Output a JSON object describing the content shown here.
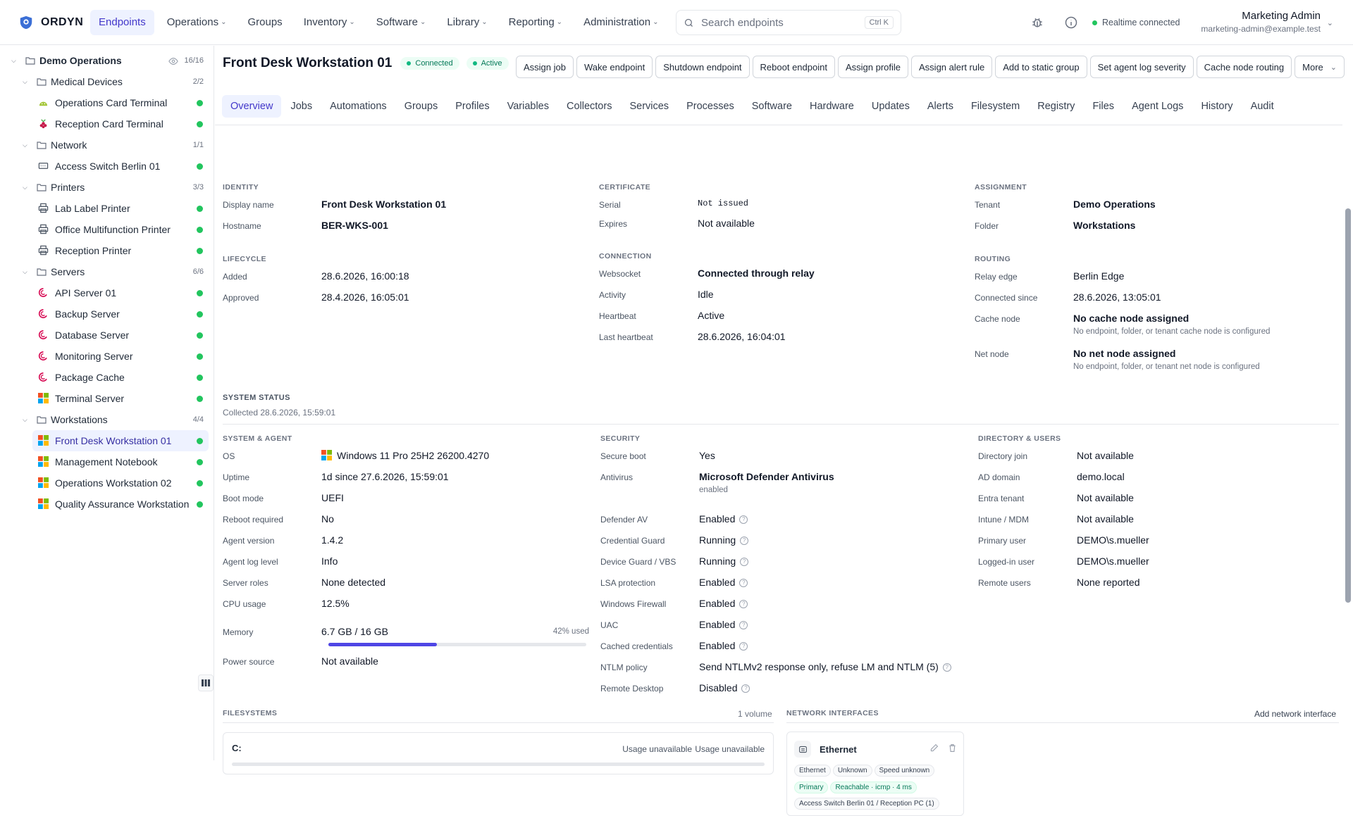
{
  "app": {
    "name": "ORDYN"
  },
  "nav": {
    "items": [
      {
        "label": "Endpoints",
        "dropdown": false,
        "active": true
      },
      {
        "label": "Operations",
        "dropdown": true
      },
      {
        "label": "Groups",
        "dropdown": false
      },
      {
        "label": "Inventory",
        "dropdown": true
      },
      {
        "label": "Software",
        "dropdown": true
      },
      {
        "label": "Library",
        "dropdown": true
      },
      {
        "label": "Reporting",
        "dropdown": true
      },
      {
        "label": "Administration",
        "dropdown": true
      }
    ]
  },
  "search": {
    "placeholder": "Search endpoints",
    "shortcut": "Ctrl K"
  },
  "realtime": {
    "label": "Realtime connected",
    "color": "#22c55e"
  },
  "user": {
    "name": "Marketing Admin",
    "email": "marketing-admin@example.test"
  },
  "tree": {
    "root": {
      "label": "Demo Operations",
      "count": "16/16"
    },
    "groups": [
      {
        "label": "Medical Devices",
        "count": "2/2",
        "items": [
          {
            "label": "Operations Card Terminal",
            "os": "android"
          },
          {
            "label": "Reception Card Terminal",
            "os": "raspberry"
          }
        ]
      },
      {
        "label": "Network",
        "count": "1/1",
        "items": [
          {
            "label": "Access Switch Berlin 01",
            "os": "switch"
          }
        ]
      },
      {
        "label": "Printers",
        "count": "3/3",
        "items": [
          {
            "label": "Lab Label Printer",
            "os": "printer"
          },
          {
            "label": "Office Multifunction Printer",
            "os": "printer"
          },
          {
            "label": "Reception Printer",
            "os": "printer"
          }
        ]
      },
      {
        "label": "Servers",
        "count": "6/6",
        "items": [
          {
            "label": "API Server 01",
            "os": "debian"
          },
          {
            "label": "Backup Server",
            "os": "debian"
          },
          {
            "label": "Database Server",
            "os": "debian"
          },
          {
            "label": "Monitoring Server",
            "os": "debian"
          },
          {
            "label": "Package Cache",
            "os": "debian"
          },
          {
            "label": "Terminal Server",
            "os": "windows"
          }
        ]
      },
      {
        "label": "Workstations",
        "count": "4/4",
        "items": [
          {
            "label": "Front Desk Workstation 01",
            "os": "windows",
            "selected": true
          },
          {
            "label": "Management Notebook",
            "os": "windows"
          },
          {
            "label": "Operations Workstation 02",
            "os": "windows"
          },
          {
            "label": "Quality Assurance Workstation",
            "os": "windows"
          }
        ]
      }
    ]
  },
  "header": {
    "title": "Front Desk Workstation 01",
    "status_connected": "Connected",
    "status_active": "Active",
    "actions": [
      "Assign job",
      "Wake endpoint",
      "Shutdown endpoint",
      "Reboot endpoint",
      "Assign profile",
      "Assign alert rule",
      "Add to static group",
      "Set agent log severity",
      "Cache node routing",
      "More"
    ]
  },
  "tabs": [
    "Overview",
    "Jobs",
    "Automations",
    "Groups",
    "Profiles",
    "Variables",
    "Collectors",
    "Services",
    "Processes",
    "Software",
    "Hardware",
    "Updates",
    "Alerts",
    "Filesystem",
    "Registry",
    "Files",
    "Agent Logs",
    "History",
    "Audit"
  ],
  "identity": {
    "title": "IDENTITY",
    "display_name_label": "Display name",
    "display_name": "Front Desk Workstation 01",
    "hostname_label": "Hostname",
    "hostname": "BER-WKS-001"
  },
  "lifecycle": {
    "title": "LIFECYCLE",
    "added_label": "Added",
    "added": "28.6.2026, 16:00:18",
    "approved_label": "Approved",
    "approved": "28.4.2026, 16:05:01"
  },
  "certificate": {
    "title": "CERTIFICATE",
    "serial_label": "Serial",
    "serial": "Not issued",
    "expires_label": "Expires",
    "expires": "Not available"
  },
  "connection": {
    "title": "CONNECTION",
    "websocket_label": "Websocket",
    "websocket": "Connected through relay",
    "activity_label": "Activity",
    "activity": "Idle",
    "heartbeat_label": "Heartbeat",
    "heartbeat": "Active",
    "last_heartbeat_label": "Last heartbeat",
    "last_heartbeat": "28.6.2026, 16:04:01"
  },
  "assignment": {
    "title": "ASSIGNMENT",
    "tenant_label": "Tenant",
    "tenant": "Demo Operations",
    "folder_label": "Folder",
    "folder": "Workstations"
  },
  "routing": {
    "title": "ROUTING",
    "relay_label": "Relay edge",
    "relay": "Berlin Edge",
    "connected_since_label": "Connected since",
    "connected_since": "28.6.2026, 13:05:01",
    "cache_label": "Cache node",
    "cache": "No cache node assigned",
    "cache_sub": "No endpoint, folder, or tenant cache node is configured",
    "net_label": "Net node",
    "net": "No net node assigned",
    "net_sub": "No endpoint, folder, or tenant net node is configured"
  },
  "system_status": {
    "title": "SYSTEM STATUS",
    "collected": "Collected 28.6.2026, 15:59:01"
  },
  "system_agent": {
    "title": "SYSTEM & AGENT",
    "rows": [
      {
        "k": "OS",
        "v": "Windows 11 Pro 25H2 26200.4270"
      },
      {
        "k": "Uptime",
        "v": "1d since 27.6.2026, 15:59:01"
      },
      {
        "k": "Boot mode",
        "v": "UEFI"
      },
      {
        "k": "Reboot required",
        "v": "No"
      },
      {
        "k": "Agent version",
        "v": "1.4.2"
      },
      {
        "k": "Agent log level",
        "v": "Info"
      },
      {
        "k": "Server roles",
        "v": "None detected"
      },
      {
        "k": "CPU usage",
        "v": "12.5%"
      }
    ],
    "memory_label": "Memory",
    "memory": "6.7 GB / 16 GB",
    "memory_used": "42% used",
    "memory_pct": 42,
    "power_label": "Power source",
    "power": "Not available"
  },
  "security": {
    "title": "SECURITY",
    "secure_boot_label": "Secure boot",
    "secure_boot": "Yes",
    "antivirus_label": "Antivirus",
    "antivirus": "Microsoft Defender Antivirus",
    "antivirus_sub": "enabled",
    "rows": [
      {
        "k": "Defender AV",
        "v": "Enabled"
      },
      {
        "k": "Credential Guard",
        "v": "Running"
      },
      {
        "k": "Device Guard / VBS",
        "v": "Running"
      },
      {
        "k": "LSA protection",
        "v": "Enabled"
      },
      {
        "k": "Windows Firewall",
        "v": "Enabled"
      },
      {
        "k": "UAC",
        "v": "Enabled"
      },
      {
        "k": "Cached credentials",
        "v": "Enabled"
      },
      {
        "k": "NTLM policy",
        "v": "Send NTLMv2 response only, refuse LM and NTLM (5)"
      },
      {
        "k": "Remote Desktop",
        "v": "Disabled"
      }
    ]
  },
  "directory": {
    "title": "DIRECTORY & USERS",
    "rows": [
      {
        "k": "Directory join",
        "v": "Not available"
      },
      {
        "k": "AD domain",
        "v": "demo.local"
      },
      {
        "k": "Entra tenant",
        "v": "Not available"
      },
      {
        "k": "Intune / MDM",
        "v": "Not available"
      },
      {
        "k": "Primary user",
        "v": "DEMO\\s.mueller"
      },
      {
        "k": "Logged-in user",
        "v": "DEMO\\s.mueller"
      },
      {
        "k": "Remote users",
        "v": "None reported"
      }
    ]
  },
  "filesystems": {
    "title": "FILESYSTEMS",
    "count": "1 volume",
    "drive": "C:",
    "usage1": "Usage unavailable",
    "usage2": "Usage unavailable"
  },
  "network": {
    "title": "NETWORK INTERFACES",
    "add_label": "Add network interface",
    "name": "Ethernet",
    "tags": [
      "Ethernet",
      "Unknown",
      "Speed unknown"
    ],
    "tags2": [
      "Primary",
      "Reachable · icmp · 4 ms"
    ],
    "link": "Access Switch Berlin 01 / Reception PC (1)"
  }
}
